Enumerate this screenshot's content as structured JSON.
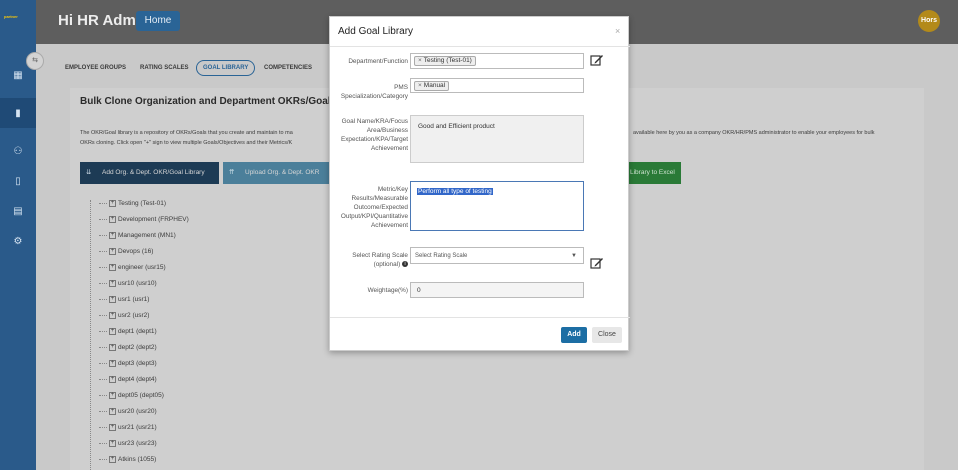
{
  "brand": {
    "logo_text": "partner"
  },
  "header": {
    "greeting": "Hi HR Admin",
    "home_label": "Home",
    "avatar_text": "Hors"
  },
  "tabs": [
    {
      "label": "EMPLOYEE GROUPS"
    },
    {
      "label": "RATING SCALES"
    },
    {
      "label": "GOAL LIBRARY"
    },
    {
      "label": "COMPETENCIES"
    }
  ],
  "card": {
    "title": "Bulk Clone Organization and Department OKRs/Goals",
    "desc_line1": "The OKR/Goal library is a repository of OKRs/Goals that you create and maintain to ma",
    "desc_line1_right": "available here by you as a company OKR/HR/PMS administrator to enable your employees for bulk",
    "desc_line2": "OKRs cloning. Click open \"+\" sign to view multiple Goals/Objectives and their Metrics/K",
    "btn_add_org": "Add Org. & Dept. OKR/Goal Library",
    "btn_upload": "Upload Org. & Dept. OKR",
    "btn_excel": "Library to Excel"
  },
  "tree": [
    "Testing (Test-01)",
    "Development (FRPHEV)",
    "Management (MN1)",
    "Devops (16)",
    "engineer (usr15)",
    "usr10 (usr10)",
    "usr1 (usr1)",
    "usr2 (usr2)",
    "dept1 (dept1)",
    "dept2 (dept2)",
    "dept3 (dept3)",
    "dept4 (dept4)",
    "dept05 (dept05)",
    "usr20 (usr20)",
    "usr21 (usr21)",
    "usr23 (usr23)",
    "Atkins (1055)"
  ],
  "modal": {
    "title": "Add Goal Library",
    "close_symbol": "×",
    "department_label": "Department/Function",
    "department_value": "Testing (Test-01)",
    "pms_label": "PMS Specialization/Category",
    "pms_value": "Manual",
    "goal_label": "Goal Name/KRA/Focus Area/Business Expectation/KPA/Target Achievement",
    "goal_value": "Good and Efficient product",
    "metric_label": "Metric/Key Results/Measurable Outcome/Expected Output/KPI/Quantitative Achievement",
    "metric_value": "Perform all type of testing",
    "rating_label": "Select Rating Scale (optional)",
    "rating_placeholder": "Select Rating Scale",
    "weightage_label": "Weightage(%)",
    "weightage_value": "0",
    "add_label": "Add",
    "close_label": "Close"
  }
}
